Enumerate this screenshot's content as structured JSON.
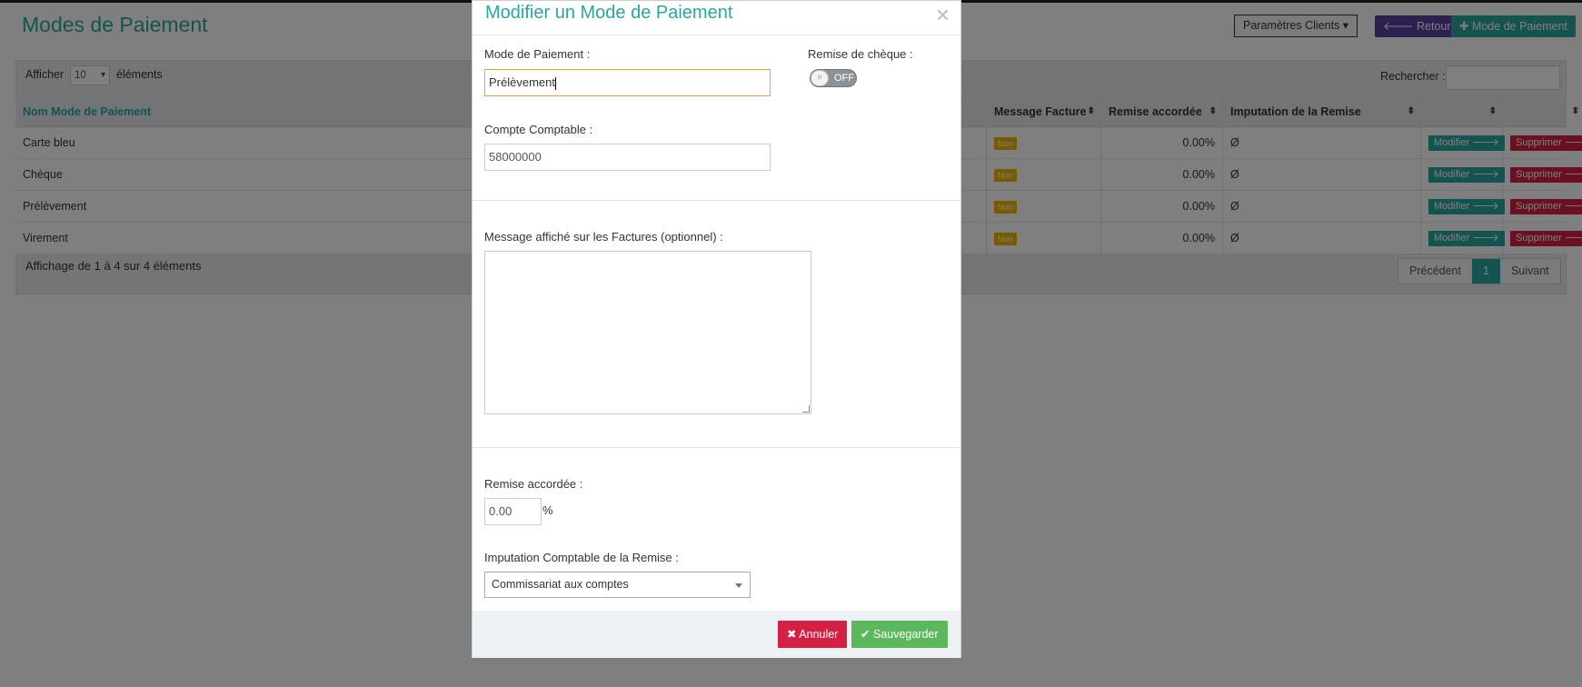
{
  "page": {
    "title": "Modes de Paiement",
    "params_button": "Paramètres Clients ▾",
    "back_button": "🡐 Retour",
    "add_button": "✚ Mode de Paiement"
  },
  "table_controls": {
    "show_label": "Afficher",
    "show_value": "10",
    "show_suffix": "éléments",
    "search_label": "Rechercher :"
  },
  "table": {
    "headers": {
      "name": "Nom Mode de Paiement",
      "message": "Message Facture",
      "discount": "Remise accordée",
      "imputation": "Imputation de la Remise"
    },
    "rows": [
      {
        "name": "Carte bleu",
        "message": "Non",
        "discount": "0.00%",
        "imputation": "Ø",
        "edit": "Modifier 🡒",
        "delete": "Supprimer 🡒"
      },
      {
        "name": "Chèque",
        "message": "Non",
        "discount": "0.00%",
        "imputation": "Ø",
        "edit": "Modifier 🡒",
        "delete": "Supprimer 🡒"
      },
      {
        "name": "Prélèvement",
        "message": "Non",
        "discount": "0.00%",
        "imputation": "Ø",
        "edit": "Modifier 🡒",
        "delete": "Supprimer 🡒"
      },
      {
        "name": "Virement",
        "message": "Non",
        "discount": "0.00%",
        "imputation": "Ø",
        "edit": "Modifier 🡒",
        "delete": "Supprimer 🡒"
      }
    ],
    "info": "Affichage de 1 à 4 sur 4 éléments",
    "pager": {
      "prev": "Précédent",
      "current": "1",
      "next": "Suivant"
    }
  },
  "modal": {
    "title": "Modifier un Mode de Paiement",
    "close": "×",
    "mode_label": "Mode de Paiement :",
    "mode_value": "Prélèvement",
    "cheque_label": "Remise de chèque :",
    "toggle_knob": "III",
    "toggle_state": "OFF",
    "account_label": "Compte Comptable :",
    "account_value": "58000000",
    "message_label": "Message affiché sur les Factures (optionnel) :",
    "discount_label": "Remise accordée :",
    "discount_value": "0.00",
    "discount_unit": "%",
    "imputation_label": "Imputation Comptable de la Remise :",
    "imputation_value": "Commissariat aux comptes",
    "cancel_button": "✖ Annuler",
    "save_button": "✔ Sauvegarder"
  },
  "colors": {
    "accent": "#2aa7a3",
    "danger": "#d61f45",
    "success": "#5cb85c",
    "warning": "#f0b400",
    "purple": "#5b3f9e"
  }
}
